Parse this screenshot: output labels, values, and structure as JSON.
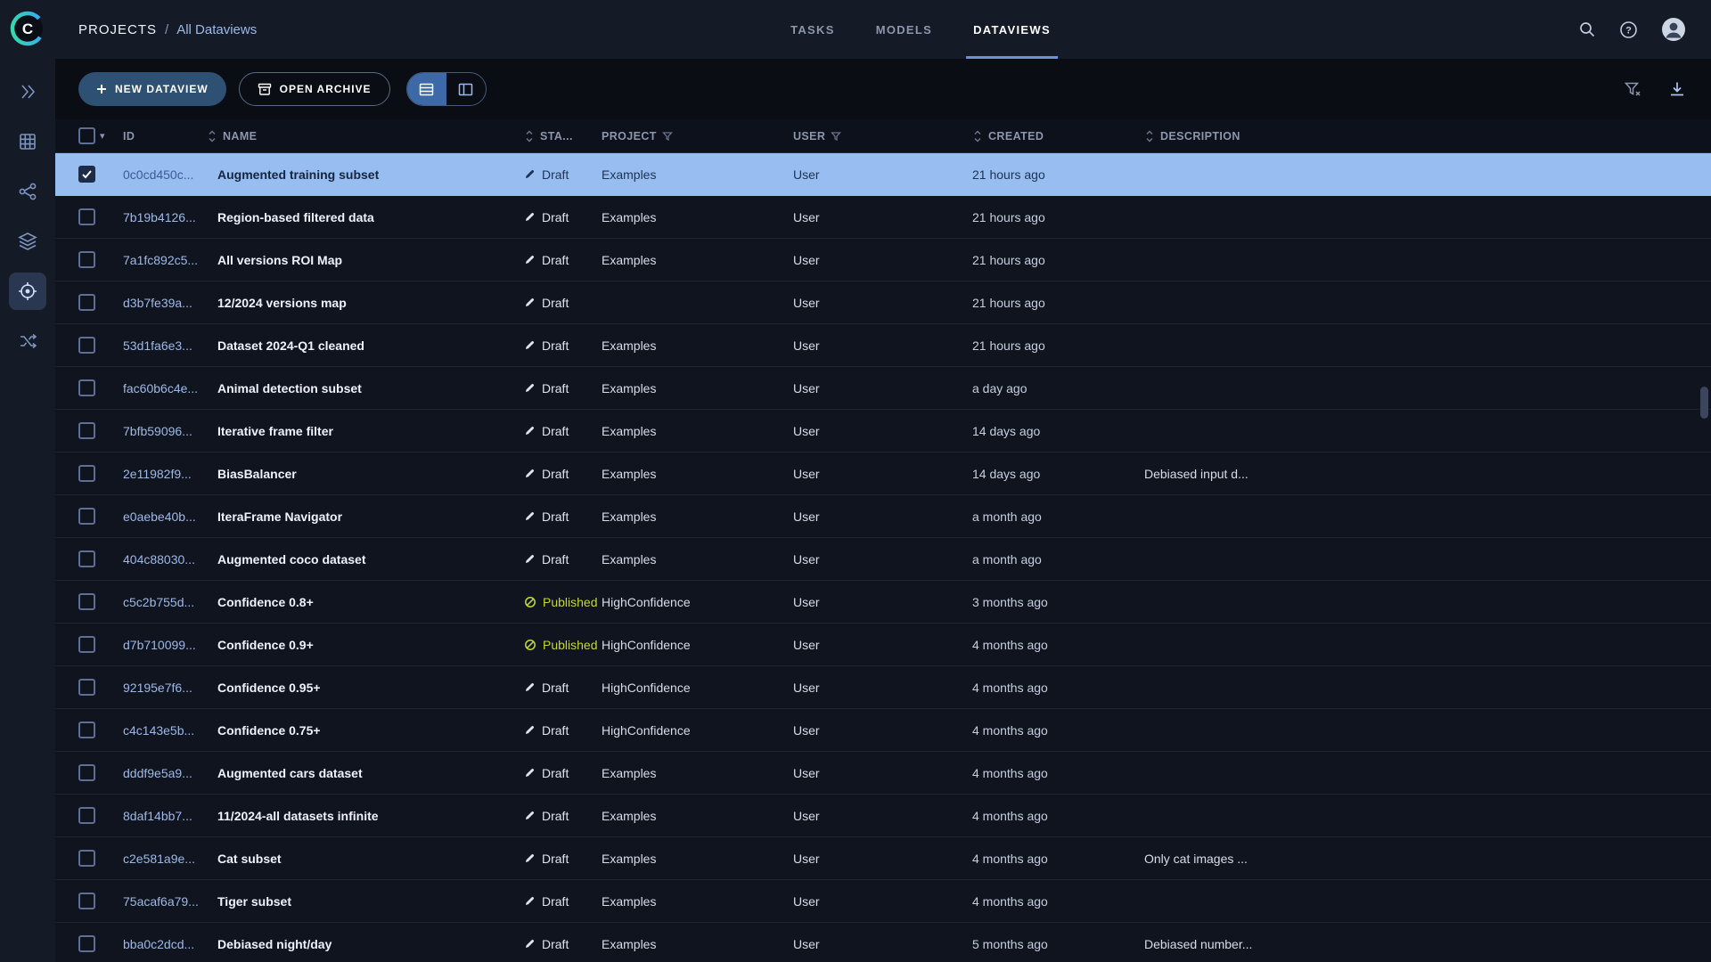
{
  "colors": {
    "accent-blue": "#9db9e8",
    "published-green": "#c3d639",
    "selected-row": "#97bdf1",
    "primary-button": "#2e5173",
    "tab-underline": "#6c92da"
  },
  "breadcrumb": {
    "root": "PROJECTS",
    "separator": "/",
    "current": "All Dataviews"
  },
  "tabs": [
    {
      "label": "TASKS",
      "active": false
    },
    {
      "label": "MODELS",
      "active": false
    },
    {
      "label": "DATAVIEWS",
      "active": true
    }
  ],
  "sidebar": {
    "items": [
      {
        "name": "projects",
        "active": false
      },
      {
        "name": "datasets",
        "active": false
      },
      {
        "name": "pipelines",
        "active": false
      },
      {
        "name": "hyperdatasets",
        "active": false
      },
      {
        "name": "dataviews",
        "active": true
      },
      {
        "name": "workflows",
        "active": false
      }
    ]
  },
  "icons": {
    "search": "magnifier",
    "help": "question-circle",
    "profile": "avatar-circle",
    "filter-reset": "funnel-with-x",
    "download": "download-tray",
    "table-view": "table-rows",
    "card-view": "split-panel",
    "draft": "pencil",
    "published": "circle-slash",
    "archive": "archive-box",
    "new-dataview": "plus"
  },
  "toolbar": {
    "new_dataview": "NEW DATAVIEW",
    "open_archive": "OPEN ARCHIVE"
  },
  "table": {
    "columns": {
      "id": "ID",
      "name": "NAME",
      "status": "STA...",
      "project": "PROJECT",
      "user": "USER",
      "created": "CREATED",
      "description": "DESCRIPTION"
    },
    "rows": [
      {
        "id": "0c0cd450c...",
        "name": "Augmented training subset",
        "status": "Draft",
        "project": "Examples",
        "user": "User",
        "created": "21 hours ago",
        "description": "",
        "selected": true
      },
      {
        "id": "7b19b4126...",
        "name": "Region-based filtered data",
        "status": "Draft",
        "project": "Examples",
        "user": "User",
        "created": "21 hours ago",
        "description": ""
      },
      {
        "id": "7a1fc892c5...",
        "name": "All versions ROI Map",
        "status": "Draft",
        "project": "Examples",
        "user": "User",
        "created": "21 hours ago",
        "description": ""
      },
      {
        "id": "d3b7fe39a...",
        "name": "12/2024 versions map",
        "status": "Draft",
        "project": "",
        "user": "User",
        "created": "21 hours ago",
        "description": ""
      },
      {
        "id": "53d1fa6e3...",
        "name": "Dataset 2024-Q1 cleaned",
        "status": "Draft",
        "project": "Examples",
        "user": "User",
        "created": "21 hours ago",
        "description": ""
      },
      {
        "id": "fac60b6c4e...",
        "name": "Animal detection subset",
        "status": "Draft",
        "project": "Examples",
        "user": "User",
        "created": "a day ago",
        "description": ""
      },
      {
        "id": "7bfb59096...",
        "name": "Iterative frame filter",
        "status": "Draft",
        "project": "Examples",
        "user": "User",
        "created": "14 days ago",
        "description": ""
      },
      {
        "id": "2e11982f9...",
        "name": "BiasBalancer",
        "status": "Draft",
        "project": "Examples",
        "user": "User",
        "created": "14 days ago",
        "description": "Debiased input d..."
      },
      {
        "id": "e0aebe40b...",
        "name": "IteraFrame Navigator",
        "status": "Draft",
        "project": "Examples",
        "user": "User",
        "created": "a month ago",
        "description": ""
      },
      {
        "id": "404c88030...",
        "name": "Augmented coco dataset",
        "status": "Draft",
        "project": "Examples",
        "user": "User",
        "created": "a month ago",
        "description": ""
      },
      {
        "id": "c5c2b755d...",
        "name": "Confidence 0.8+",
        "status": "Published",
        "project": "HighConfidence",
        "user": "User",
        "created": "3 months ago",
        "description": ""
      },
      {
        "id": "d7b710099...",
        "name": "Confidence 0.9+",
        "status": "Published",
        "project": "HighConfidence",
        "user": "User",
        "created": "4 months ago",
        "description": ""
      },
      {
        "id": "92195e7f6...",
        "name": "Confidence 0.95+",
        "status": "Draft",
        "project": "HighConfidence",
        "user": "User",
        "created": "4 months ago",
        "description": ""
      },
      {
        "id": "c4c143e5b...",
        "name": "Confidence 0.75+",
        "status": "Draft",
        "project": "HighConfidence",
        "user": "User",
        "created": "4 months ago",
        "description": ""
      },
      {
        "id": "dddf9e5a9...",
        "name": "Augmented cars dataset",
        "status": "Draft",
        "project": "Examples",
        "user": "User",
        "created": "4 months ago",
        "description": ""
      },
      {
        "id": "8daf14bb7...",
        "name": "11/2024-all datasets infinite",
        "status": "Draft",
        "project": "Examples",
        "user": "User",
        "created": "4 months ago",
        "description": ""
      },
      {
        "id": "c2e581a9e...",
        "name": "Cat subset",
        "status": "Draft",
        "project": "Examples",
        "user": "User",
        "created": "4 months ago",
        "description": "Only cat images ..."
      },
      {
        "id": "75acaf6a79...",
        "name": "Tiger subset",
        "status": "Draft",
        "project": "Examples",
        "user": "User",
        "created": "4 months ago",
        "description": ""
      },
      {
        "id": "bba0c2dcd...",
        "name": "Debiased night/day",
        "status": "Draft",
        "project": "Examples",
        "user": "User",
        "created": "5 months ago",
        "description": "Debiased number..."
      }
    ]
  }
}
